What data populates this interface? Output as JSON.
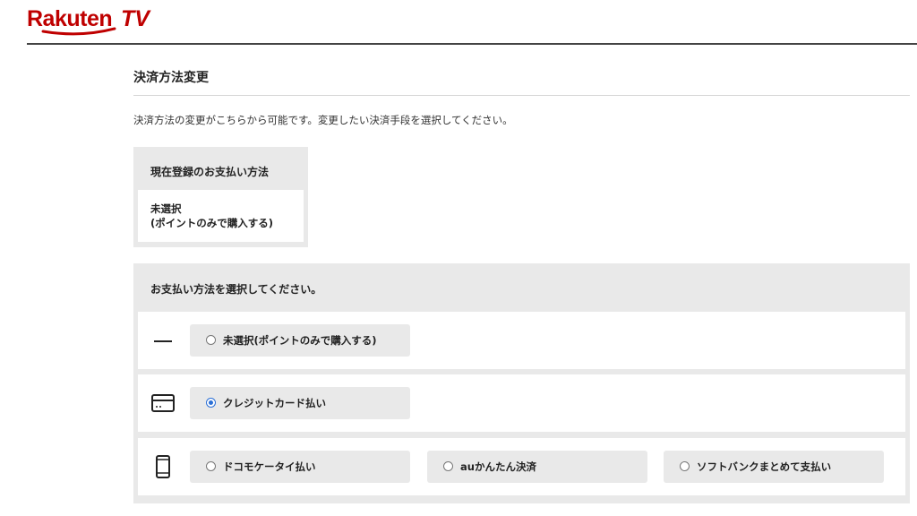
{
  "brand": {
    "logo_text": "Rakuten TV",
    "logo_color": "#bf0000"
  },
  "page": {
    "title": "決済方法変更",
    "description": "決済方法の変更がこちらから可能です。変更したい決済手段を選択してください。"
  },
  "current": {
    "heading": "現在登録のお支払い方法",
    "value_line1": "未選択",
    "value_line2": "(ポイントのみで購入する)"
  },
  "selection": {
    "heading": "お支払い方法を選択してください。",
    "rows": [
      {
        "icon": "dash-icon",
        "options": [
          {
            "label": "未選択(ポイントのみで購入する)",
            "selected": false
          }
        ]
      },
      {
        "icon": "credit-card-icon",
        "options": [
          {
            "label": "クレジットカード払い",
            "selected": true
          }
        ]
      },
      {
        "icon": "mobile-phone-icon",
        "options": [
          {
            "label": "ドコモケータイ払い",
            "selected": false
          },
          {
            "label": "auかんたん決済",
            "selected": false
          },
          {
            "label": "ソフトバンクまとめて支払い",
            "selected": false
          }
        ]
      }
    ]
  },
  "colors": {
    "accent_radio": "#2b6fd6",
    "panel_gray": "#e9e9e9"
  }
}
